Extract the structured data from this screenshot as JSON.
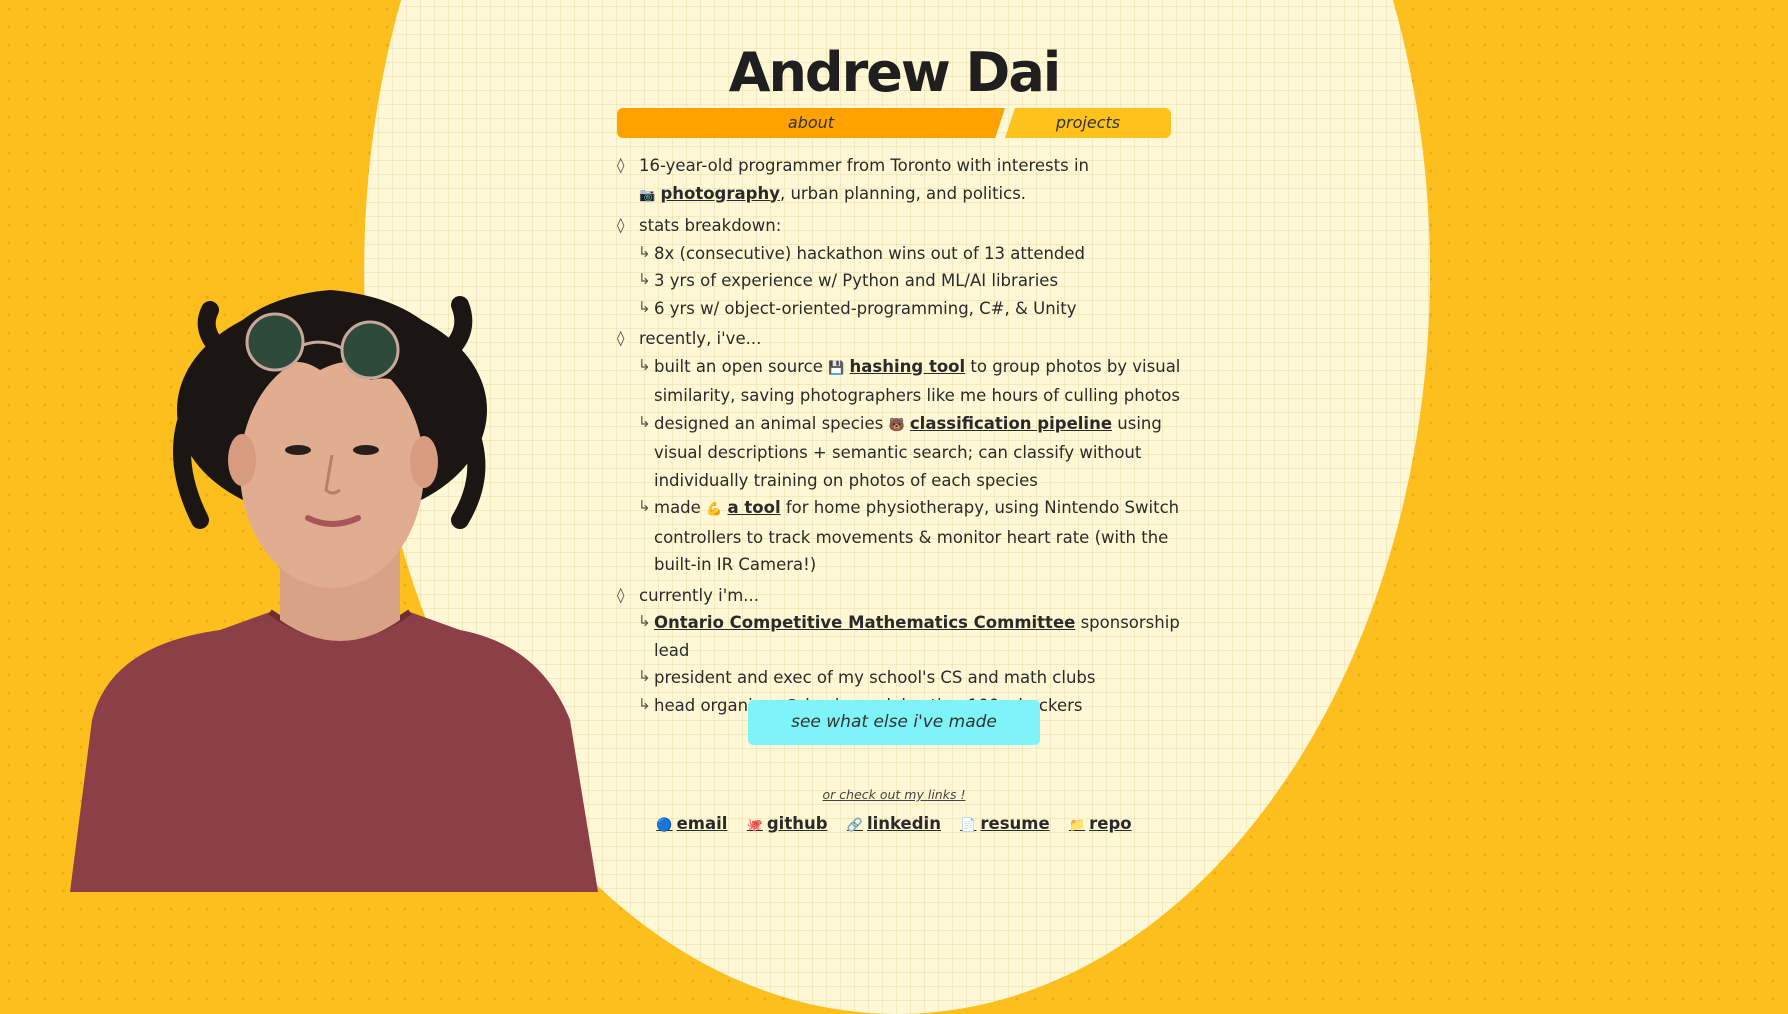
{
  "header": {
    "name": "Andrew Dai"
  },
  "tabs": [
    {
      "label": "about"
    },
    {
      "label": "projects"
    }
  ],
  "icons": {
    "diamond": "◊",
    "arrow": "↳",
    "camera": "📷",
    "floppy": "💾",
    "bear": "🐻",
    "flexed_biceps": "💪",
    "email": "🔵",
    "github": "🐙",
    "linkedin": "🔗",
    "resume": "📄",
    "repo": "📁"
  },
  "about": {
    "intro": {
      "before": "16-year-old programmer from Toronto with interests in",
      "link": "photography",
      "after": ", urban planning, and politics."
    },
    "stats": {
      "heading": "stats breakdown:",
      "items": [
        "8x (consecutive) hackathon wins out of 13 attended",
        "3 yrs of experience w/ Python and ML/AI libraries",
        "6 yrs w/ object-oriented-programming, C#, & Unity"
      ]
    },
    "recent": {
      "heading": "recently, i've...",
      "items": [
        {
          "before": "built an open source",
          "link": "hashing tool",
          "after": "to group photos by visual similarity, saving photographers like me hours of culling photos"
        },
        {
          "before": "designed an animal species",
          "link": "classification pipeline",
          "after": "using visual descriptions + semantic search; can classify without individually training on photos of each species"
        },
        {
          "before": "made",
          "link": "a tool",
          "after": "for home physiotherapy, using Nintendo Switch controllers to track movements & monitor heart rate (with the built-in IR Camera!)"
        }
      ]
    },
    "current": {
      "heading": "currently i'm...",
      "item1": {
        "link": "Ontario Competitive Mathematics Committee",
        "after": "sponsorship lead"
      },
      "item2": "president and exec of my school's CS and math clubs",
      "item3": "head organizer @ hack::peel, hosting 100+ hackers"
    }
  },
  "cta": {
    "label": "see what else i've made"
  },
  "footer": {
    "prompt": "or check out my links !",
    "links": [
      {
        "label": "email"
      },
      {
        "label": "github"
      },
      {
        "label": "linkedin"
      },
      {
        "label": "resume"
      },
      {
        "label": "repo"
      }
    ]
  },
  "colors": {
    "background": "#fcbf1e",
    "panel": "#fff8d6",
    "tab_active": "#ffa200",
    "tab_inactive": "#ffc21c",
    "cta": "#7ef4f9",
    "text": "#2a2a2a"
  }
}
